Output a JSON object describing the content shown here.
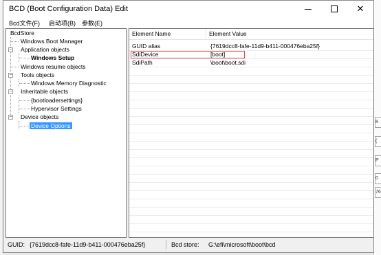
{
  "window": {
    "title": "BCD (Boot Configuration Data) Edit"
  },
  "menu": {
    "items": [
      "Bcd文件(F)",
      "启动项(B)",
      "参数(E)"
    ]
  },
  "tree": {
    "root": "BcdStore",
    "windows_boot_manager": "Windows Boot Manager",
    "application_objects": "Application objects",
    "windows_setup": "Windows Setup",
    "windows_resume_objects": "Windows resume objects",
    "tools_objects": "Tools objects",
    "windows_memory_diagnostic": "Windows Memory Diagnostic",
    "inheritable_objects": "Inheritable objects",
    "bootloadersettings": "{bootloadersettings}",
    "hypervisor_settings": "Hypervisor Settings",
    "device_objects": "Device objects",
    "device_options": "Device Options"
  },
  "list": {
    "columns": [
      "Element Name",
      "Element Value"
    ],
    "rows": [
      {
        "name": "GUID alias",
        "value": "{7619dcc8-fafe-11d9-b411-000476eba25f}"
      },
      {
        "name": "SdiDevice",
        "value": "[boot]"
      },
      {
        "name": "SdiPath",
        "value": "\\boot\\boot.sdi"
      }
    ]
  },
  "status": {
    "guid_label": "GUID:",
    "guid_value": "{7619dcc8-fafe-11d9-b411-000476eba25f}",
    "store_label": "Bcd store:",
    "store_value": "G:\\efi\\microsoft\\boot\\bcd"
  },
  "background": {
    "edge_fragments": [
      "K",
      "(",
      "P",
      "0",
      "76"
    ]
  },
  "colors": {
    "selection": "#3399ff",
    "highlight_border": "#e0474c"
  },
  "icons": {
    "minimize": "minimize-icon",
    "maximize": "maximize-icon",
    "close": "close-icon",
    "collapse": "collapse-icon"
  }
}
